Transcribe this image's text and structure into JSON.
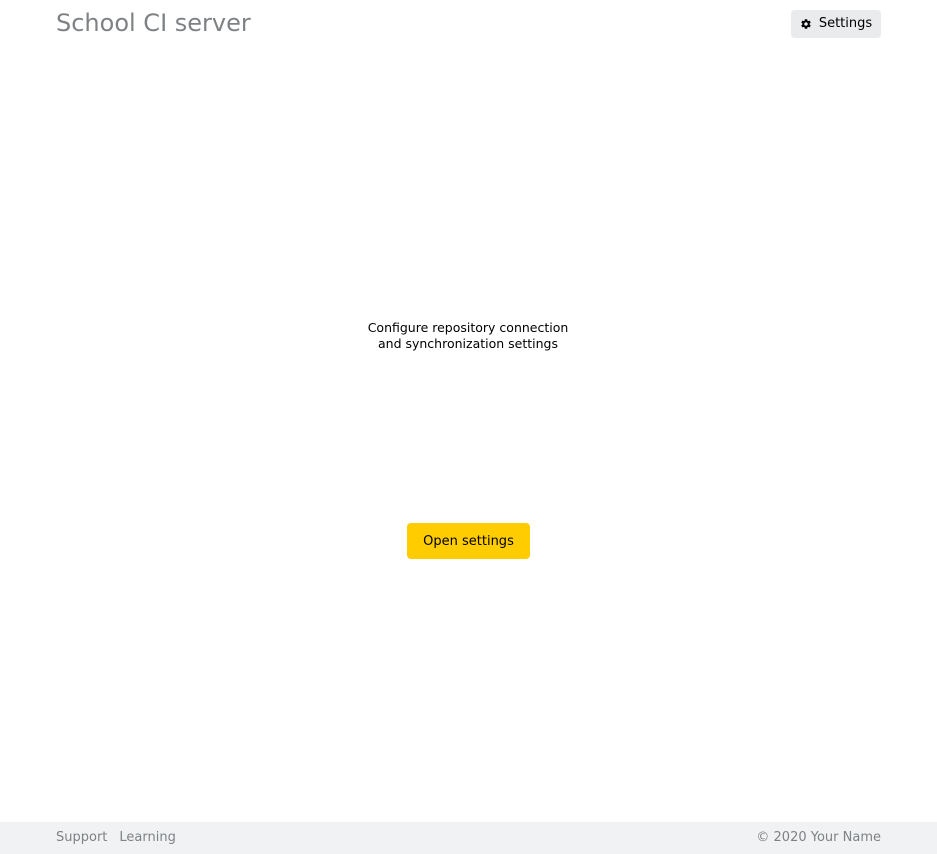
{
  "header": {
    "title": "School CI server",
    "settings_label": "Settings",
    "settings_icon": "gear-icon"
  },
  "main": {
    "hint_line1": "Configure repository connection",
    "hint_line2": "and synchronization settings",
    "open_settings_label": "Open settings"
  },
  "footer": {
    "links": [
      {
        "label": "Support"
      },
      {
        "label": "Learning"
      }
    ],
    "copyright": "© 2020 Your Name"
  },
  "colors": {
    "accent": "#ffcc00",
    "header_text": "#7f8285",
    "settings_button_bg": "#e9ebed",
    "footer_bg": "#f0f2f3"
  }
}
